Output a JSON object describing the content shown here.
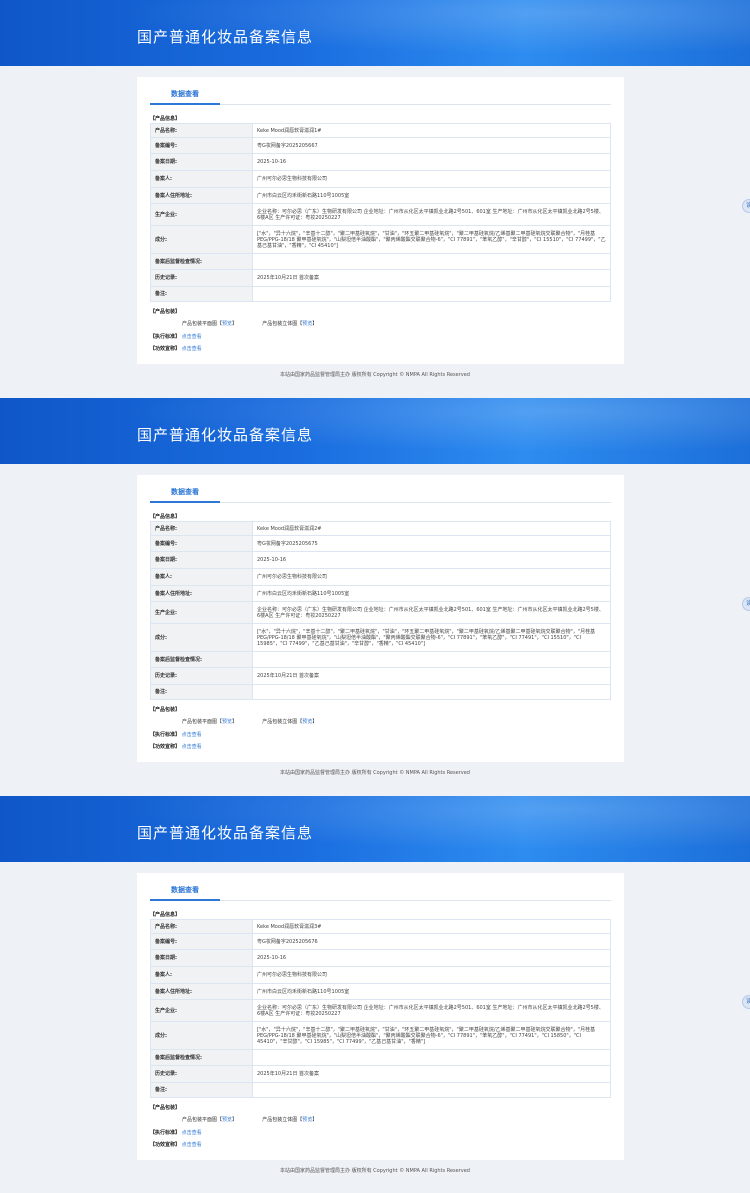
{
  "page_title": "国产普通化妆品备案信息",
  "tab_label": "数据查看",
  "section_product_info": "【产品信息】",
  "section_package": "【产品包装】",
  "package_front_label": "产品包装平面图",
  "package_3d_label": "产品包装立体图",
  "preview_label": "预览",
  "bracket_open": "【",
  "bracket_close": "】",
  "standard_label": "【执行标准】",
  "efficacy_label": "【功效宣称】",
  "click_view": "点击查看",
  "footer_text": "本站由国家药品监督管理局主办 版权所有 Copyright © NMPA All Rights Reserved",
  "side_button_text": "读",
  "field_labels": {
    "name": "产品名称:",
    "number": "备案编号:",
    "date": "备案日期:",
    "filer": "备案人:",
    "address": "备案人住所地址:",
    "producer": "生产企业:",
    "ingredients": "成分:",
    "inspection": "备案后监督检查情况:",
    "history": "历史记录:",
    "remarks": "备注:"
  },
  "records": [
    {
      "name": "Keke Mood润唇软膏滋润1#",
      "number": "粤G妆网备字2025205667",
      "date": "2025-10-16",
      "filer": "广州可尔必思生物科技有限公司",
      "address": "广州市白云区均禾街新石路110号1005室",
      "producer": "企业名称：可尔必思（广东）生物研发有限公司 企业地址：广州市从化区太平镇凯业北路2号501、601室 生产地址：广州市从化区太平镇凯业北路2号5楼、6楼A区 生产许可证：粤妆20250227",
      "ingredients": "[\"水\"，\"异十六烷\"，\"辛基十二醇\"，\"聚二甲基硅氧烷\"，\"甘油\"，\"环五聚二甲基硅氧烷\"，\"聚二甲基硅氧烷/乙烯基聚二甲基硅氧烷交联聚合物\"，\"月桂基 PEG/PPG-18/18 聚甲基硅氧烷\"，\"山梨坦倍半油酸酯\"，\"聚丙烯酸酯交联聚合物-6\"，\"CI 77891\"，\"苯氧乙醇\"，\"辛甘醇\"，\"CI 15510\"，\"CI 77499\"，\"乙基己基甘油\"，\"香精\"，\"CI 45410\"]",
      "inspection": "",
      "history": "2025年10月21日 首次备案",
      "remarks": ""
    },
    {
      "name": "Keke Mood润唇软膏滋润2#",
      "number": "粤G妆网备字2025205675",
      "date": "2025-10-16",
      "filer": "广州可尔必思生物科技有限公司",
      "address": "广州市白云区均禾街新石路110号1005室",
      "producer": "企业名称：可尔必思（广东）生物研发有限公司 企业地址：广州市从化区太平镇凯业北路2号501、601室 生产地址：广州市从化区太平镇凯业北路2号5楼、6楼A区 生产许可证：粤妆20250227",
      "ingredients": "[\"水\"，\"异十六烷\"，\"辛基十二醇\"，\"聚二甲基硅氧烷\"，\"甘油\"，\"环五聚二甲基硅氧烷\"，\"聚二甲基硅氧烷/乙烯基聚二甲基硅氧烷交联聚合物\"，\"月桂基 PEG/PPG-18/18 聚甲基硅氧烷\"，\"山梨坦倍半油酸酯\"，\"聚丙烯酸酯交联聚合物-6\"，\"CI 77891\"，\"苯氧乙醇\"，\"CI 77491\"，\"CI 15510\"，\"CI 15985\"，\"CI 77499\"，\"乙基己基甘油\"，\"辛甘醇\"，\"香精\"，\"CI 45410\"]",
      "inspection": "",
      "history": "2025年10月21日 首次备案",
      "remarks": ""
    },
    {
      "name": "Keke Mood润唇软膏滋润3#",
      "number": "粤G妆网备字2025205676",
      "date": "2025-10-16",
      "filer": "广州可尔必思生物科技有限公司",
      "address": "广州市白云区均禾街新石路110号1005室",
      "producer": "企业名称：可尔必思（广东）生物研发有限公司 企业地址：广州市从化区太平镇凯业北路2号501、601室 生产地址：广州市从化区太平镇凯业北路2号5楼、6楼A区 生产许可证：粤妆20250227",
      "ingredients": "[\"水\"，\"异十六烷\"，\"辛基十二醇\"，\"聚二甲基硅氧烷\"，\"甘油\"，\"环五聚二甲基硅氧烷\"，\"聚二甲基硅氧烷/乙烯基聚二甲基硅氧烷交联聚合物\"，\"月桂基 PEG/PPG-18/18 聚甲基硅氧烷\"，\"山梨坦倍半油酸酯\"，\"聚丙烯酸酯交联聚合物-6\"，\"CI 77891\"，\"苯氧乙醇\"，\"CI 77491\"，\"CI 15850\"，\"CI 45410\"，\"辛甘醇\"，\"CI 15985\"，\"CI 77499\"，\"乙基己基甘油\"，\"香精\"]",
      "inspection": "",
      "history": "2025年10月21日 首次备案",
      "remarks": ""
    }
  ]
}
